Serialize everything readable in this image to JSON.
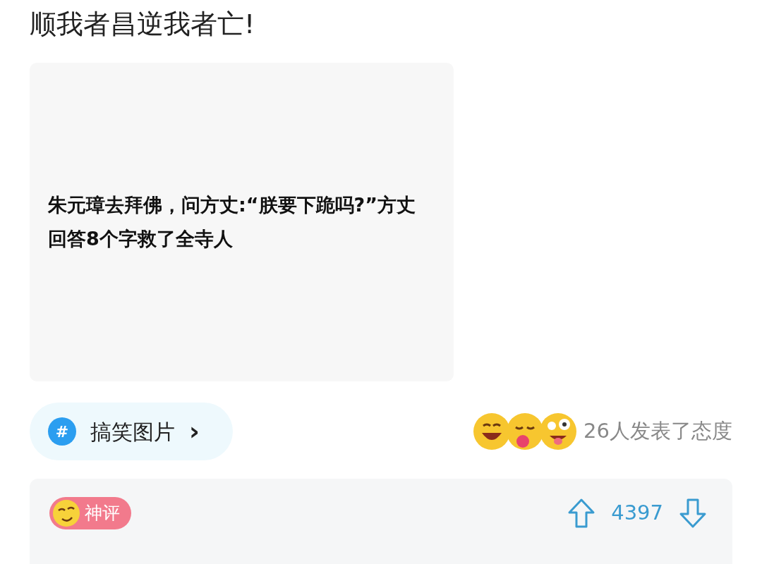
{
  "post": {
    "title": "顺我者昌逆我者亡!"
  },
  "article_card": {
    "caption": "朱元璋去拜佛，问方丈:“朕要下跪吗?”方丈回答8个字救了全寺人"
  },
  "topic": {
    "icon": "#",
    "label": "搞笑图片",
    "chevron": "›"
  },
  "reactions": {
    "summary": "26人发表了态度"
  },
  "comment": {
    "badge": "神评",
    "votes": "4397"
  }
}
